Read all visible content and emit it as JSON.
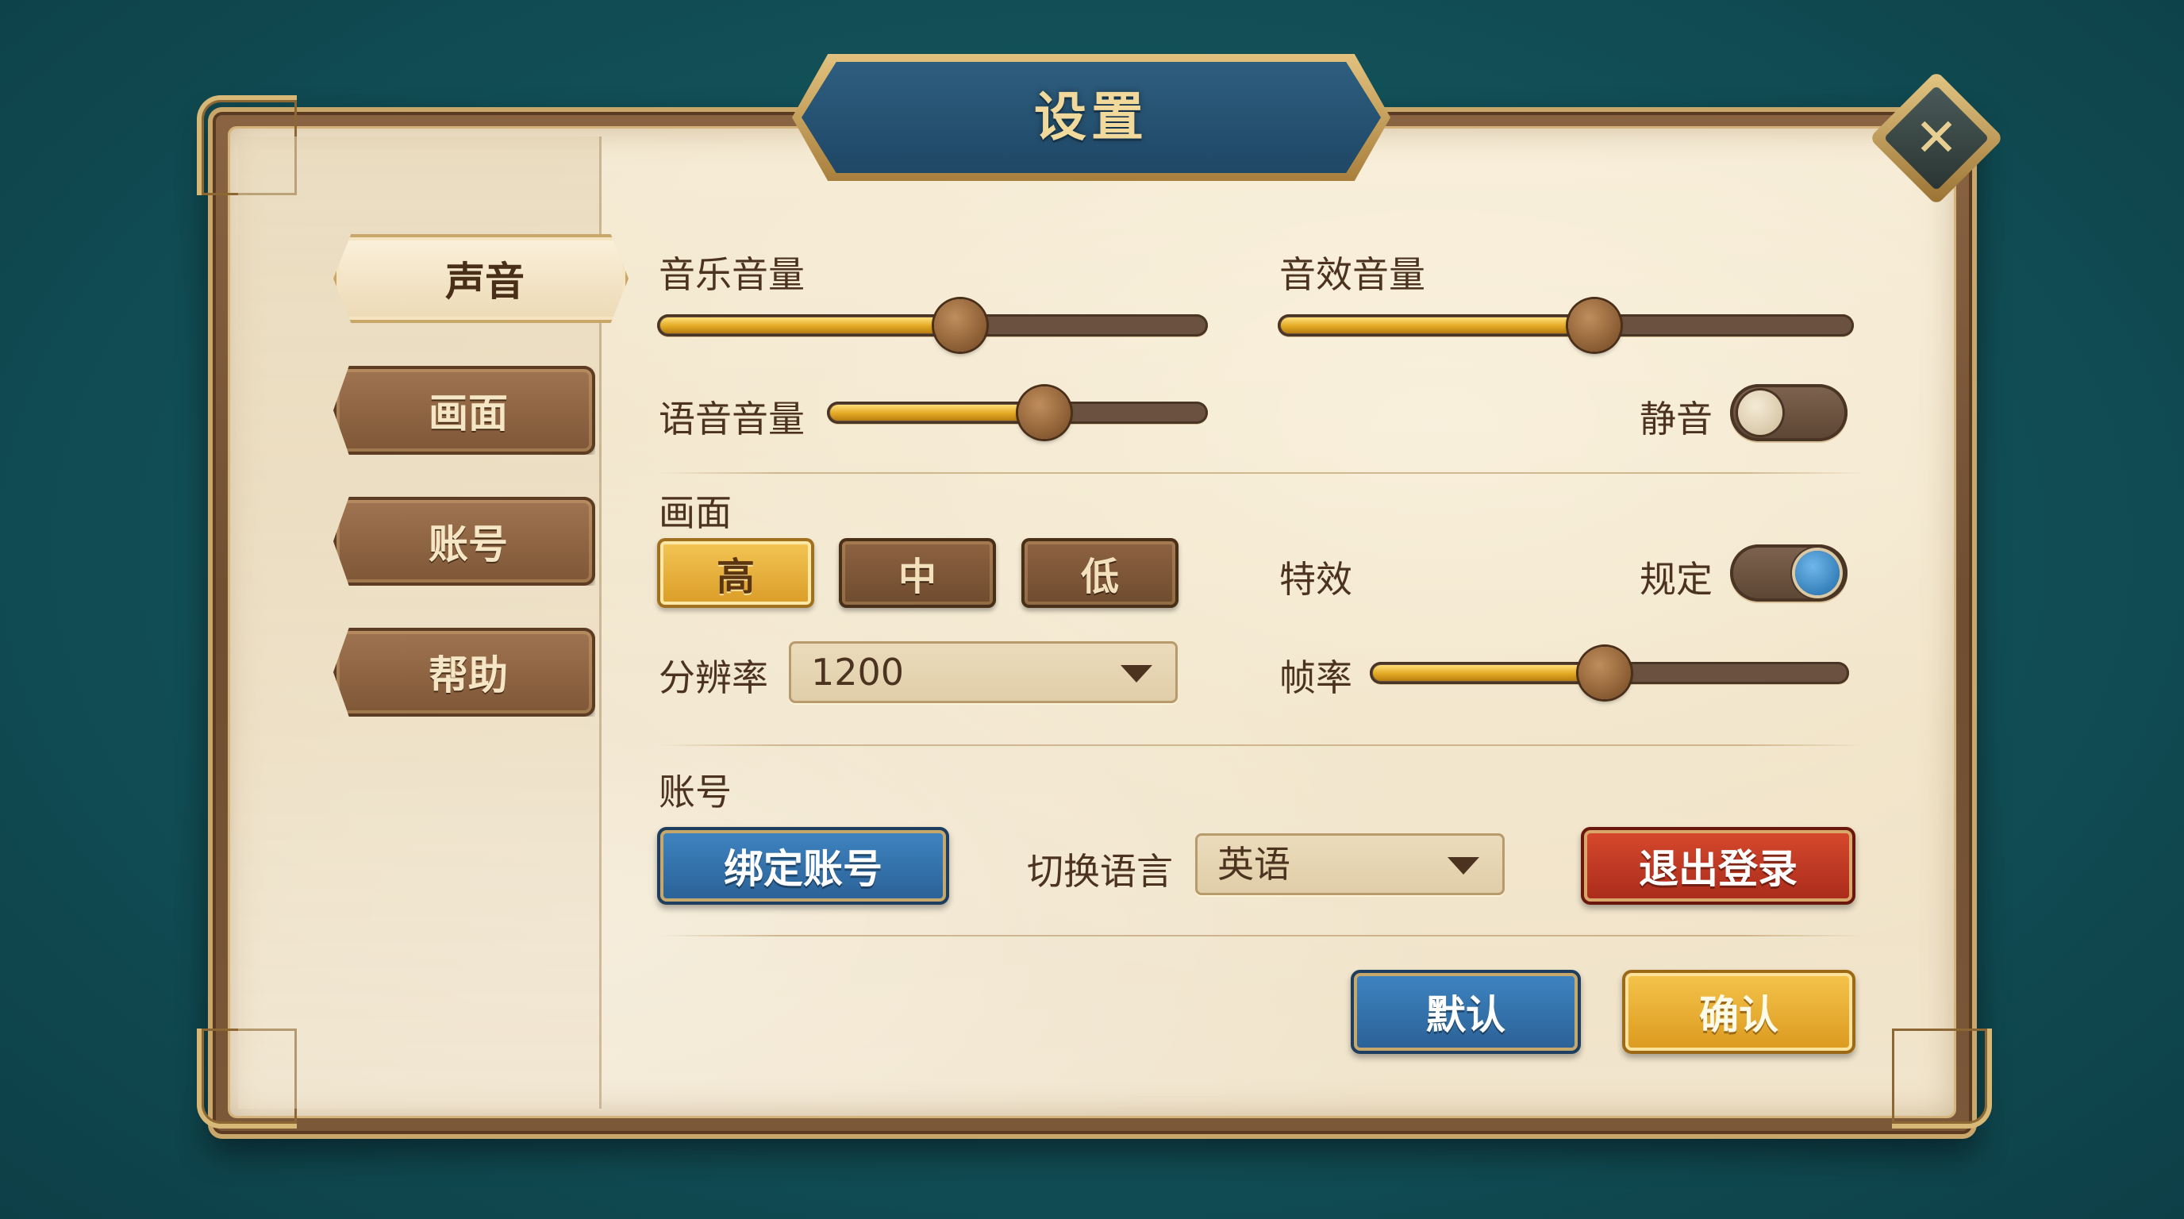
{
  "title": "设置",
  "close_label": "✕",
  "sidebar": {
    "tabs": [
      {
        "label": "声音",
        "active": true
      },
      {
        "label": "画面",
        "active": false
      },
      {
        "label": "账号",
        "active": false
      },
      {
        "label": "帮助",
        "active": false
      }
    ]
  },
  "sound": {
    "music_volume": {
      "label": "音乐音量",
      "value": 0.55
    },
    "sfx_volume": {
      "label": "音效音量",
      "value": 0.55
    },
    "voice_volume": {
      "label": "语音音量",
      "value": 0.57
    },
    "mute": {
      "label": "静音",
      "on": false
    }
  },
  "graphics": {
    "section_label": "画面",
    "quality_options": [
      {
        "label": "高",
        "selected": true
      },
      {
        "label": "中",
        "selected": false
      },
      {
        "label": "低",
        "selected": false
      }
    ],
    "effects": {
      "label": "特效",
      "mode_label": "规定",
      "on": true
    },
    "resolution": {
      "label": "分辨率",
      "value": "1200"
    },
    "framerate": {
      "label": "帧率",
      "value": 0.49
    }
  },
  "account": {
    "section_label": "账号",
    "bind_label": "绑定账号",
    "language_label": "切换语言",
    "language_value": "英语",
    "logout_label": "退出登录"
  },
  "footer": {
    "default_label": "默认",
    "confirm_label": "确认"
  },
  "colors": {
    "background": "#124f57",
    "title_banner": "#1f4766",
    "slider_fill": "#e3a923",
    "toggle_on_dot": "#2b7fc1",
    "logout": "#c0391f"
  }
}
